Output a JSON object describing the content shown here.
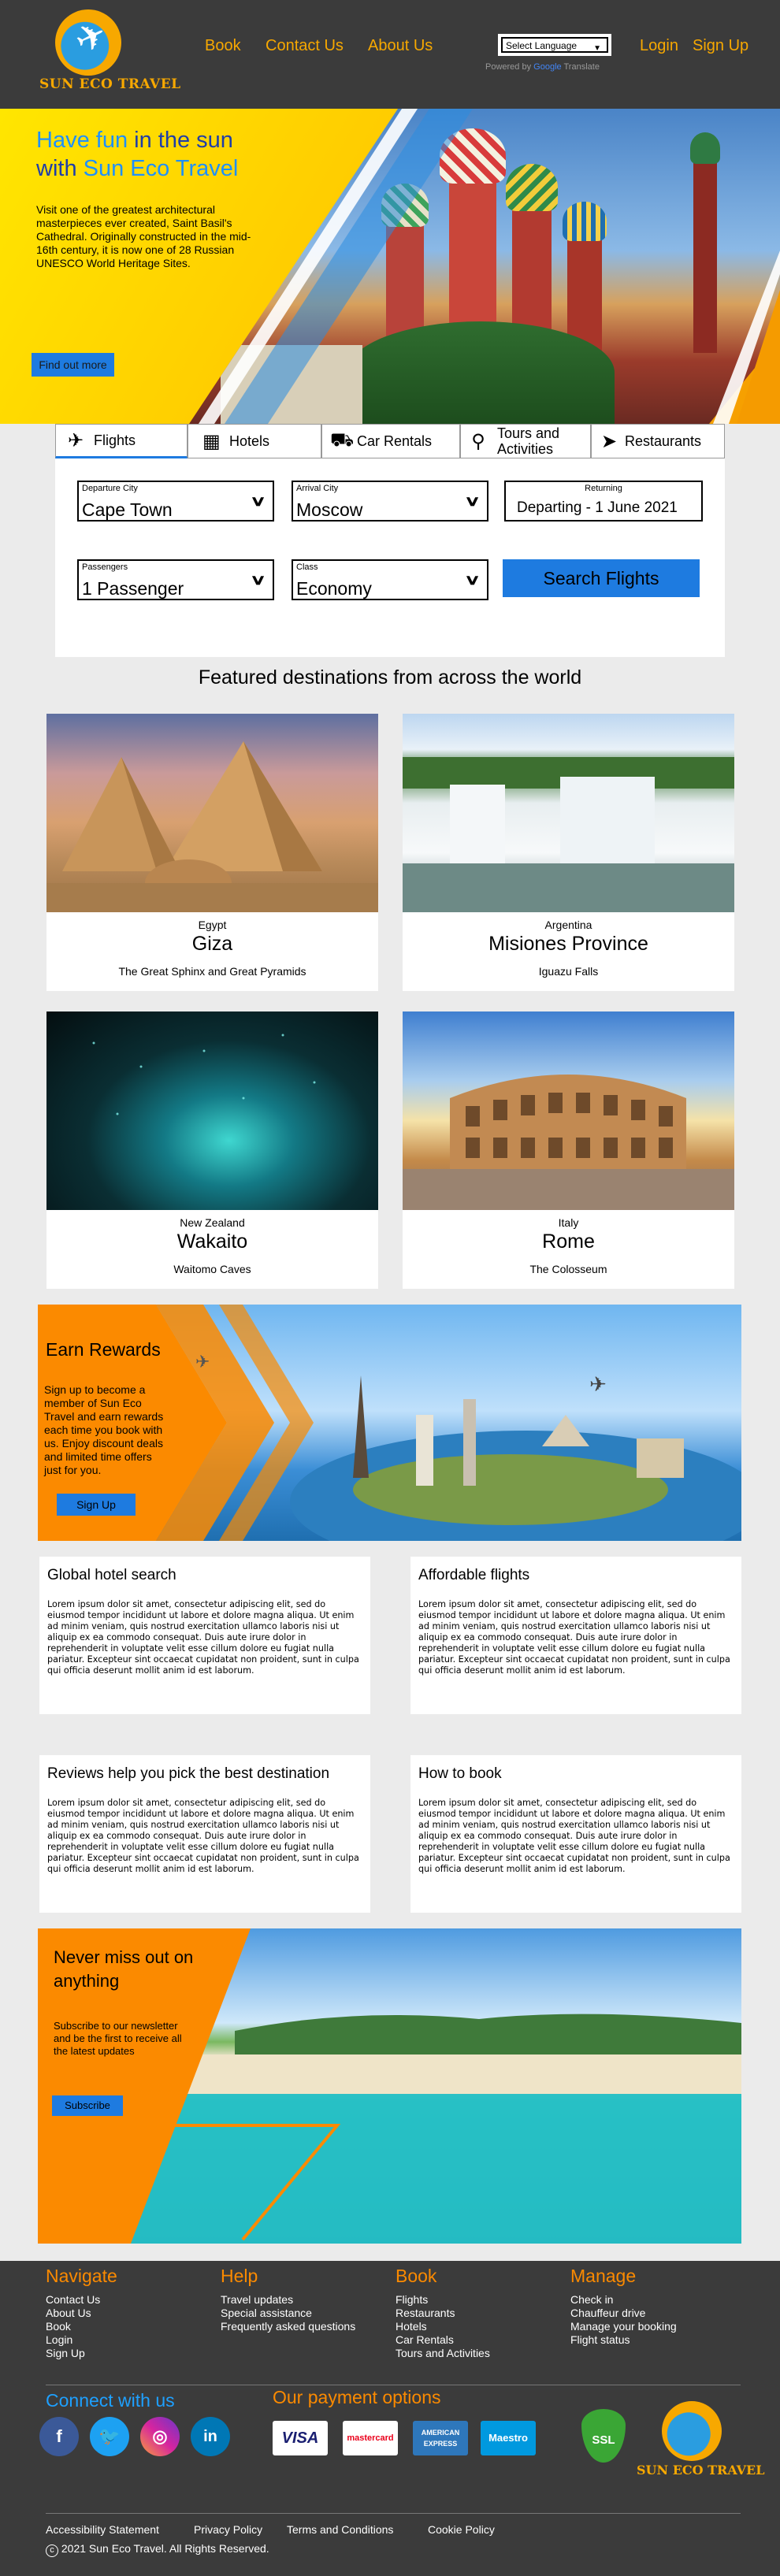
{
  "brand": {
    "name": "SUN ECO TRAVEL"
  },
  "nav": {
    "book": "Book",
    "contact": "Contact Us",
    "about": "About Us",
    "login": "Login",
    "signup": "Sign Up"
  },
  "translate": {
    "select_label": "Select Language",
    "powered_prefix": "Powered by",
    "google": "Google",
    "translate_word": "Translate"
  },
  "hero": {
    "title_part1": "Have fun",
    "title_part2": " in the sun",
    "title_part3": "with ",
    "title_part4": "Sun Eco Travel",
    "text": "Visit one of the greatest architectural masterpieces ever created, Saint Basil's Cathedral. Originally constructed in the mid-16th century, it is now one of 28 Russian UNESCO World Heritage Sites.",
    "button": "Find out more"
  },
  "search": {
    "tabs": [
      {
        "label": "Flights",
        "icon": "airplane-icon"
      },
      {
        "label": "Hotels",
        "icon": "hotel-icon"
      },
      {
        "label": "Car Rentals",
        "icon": "car-icon"
      },
      {
        "label": "Tours and Activities",
        "icon": "bicycle-icon"
      },
      {
        "label": "Restaurants",
        "icon": "restaurant-icon"
      }
    ],
    "departure": {
      "label": "Departure City",
      "value": "Cape Town"
    },
    "arrival": {
      "label": "Arrival City",
      "value": "Moscow"
    },
    "returning": {
      "label": "Returning",
      "value": "Departing - 1 June 2021"
    },
    "passengers": {
      "label": "Passengers",
      "value": "1 Passenger"
    },
    "class": {
      "label": "Class",
      "value": "Economy"
    },
    "button": "Search Flights"
  },
  "featured": {
    "title": "Featured destinations from across the world",
    "cards": [
      {
        "country": "Egypt",
        "city": "Giza",
        "desc": "The Great Sphinx and Great Pyramids"
      },
      {
        "country": "Argentina",
        "city": "Misiones Province",
        "desc": "Iguazu Falls"
      },
      {
        "country": "New Zealand",
        "city": "Wakaito",
        "desc": "Waitomo Caves"
      },
      {
        "country": "Italy",
        "city": "Rome",
        "desc": "The Colosseum"
      }
    ]
  },
  "rewards": {
    "title": "Earn Rewards",
    "text": "Sign up to become a member of Sun Eco Travel and earn rewards each time you book with us. Enjoy discount deals and limited time offers just for you.",
    "button": "Sign Up"
  },
  "info": [
    {
      "title": "Global hotel search",
      "text": "Lorem ipsum dolor sit amet, consectetur adipiscing elit, sed do eiusmod tempor incididunt ut labore et dolore magna aliqua. Ut enim ad minim veniam, quis nostrud exercitation ullamco laboris nisi ut aliquip ex ea commodo consequat. Duis aute irure dolor in reprehenderit in voluptate velit esse cillum dolore eu fugiat nulla pariatur. Excepteur sint occaecat cupidatat non proident, sunt in culpa qui officia deserunt mollit anim id est laborum."
    },
    {
      "title": "Affordable flights",
      "text": "Lorem ipsum dolor sit amet, consectetur adipiscing elit, sed do eiusmod tempor incididunt ut labore et dolore magna aliqua. Ut enim ad minim veniam, quis nostrud exercitation ullamco laboris nisi ut aliquip ex ea commodo consequat. Duis aute irure dolor in reprehenderit in voluptate velit esse cillum dolore eu fugiat nulla pariatur. Excepteur sint occaecat cupidatat non proident, sunt in culpa qui officia deserunt mollit anim id est laborum."
    },
    {
      "title": "Reviews help you pick the best destination",
      "text": "Lorem ipsum dolor sit amet, consectetur adipiscing elit, sed do eiusmod tempor incididunt ut labore et dolore magna aliqua. Ut enim ad minim veniam, quis nostrud exercitation ullamco laboris nisi ut aliquip ex ea commodo consequat. Duis aute irure dolor in reprehenderit in voluptate velit esse cillum dolore eu fugiat nulla pariatur. Excepteur sint occaecat cupidatat non proident, sunt in culpa qui officia deserunt mollit anim id est laborum."
    },
    {
      "title": "How to book",
      "text": "Lorem ipsum dolor sit amet, consectetur adipiscing elit, sed do eiusmod tempor incididunt ut labore et dolore magna aliqua. Ut enim ad minim veniam, quis nostrud exercitation ullamco laboris nisi ut aliquip ex ea commodo consequat. Duis aute irure dolor in reprehenderit in voluptate velit esse cillum dolore eu fugiat nulla pariatur. Excepteur sint occaecat cupidatat non proident, sunt in culpa qui officia deserunt mollit anim id est laborum."
    }
  ],
  "newsletter": {
    "title": "Never miss out on anything",
    "text": "Subscribe to our newsletter and be the first to receive all the latest updates",
    "button": "Subscribe"
  },
  "footer": {
    "navigate": {
      "title": "Navigate",
      "items": [
        "Contact Us",
        "About Us",
        "Book",
        "Login",
        "Sign Up"
      ]
    },
    "help": {
      "title": "Help",
      "items": [
        "Travel updates",
        "Special assistance",
        "Frequently asked questions"
      ]
    },
    "book": {
      "title": "Book",
      "items": [
        "Flights",
        "Restaurants",
        "Hotels",
        "Car Rentals",
        "Tours and Activities"
      ]
    },
    "manage": {
      "title": "Manage",
      "items": [
        "Check in",
        "Chauffeur drive",
        "Manage your booking",
        "Flight status"
      ]
    },
    "connect_title": "Connect with us",
    "payment_title": "Our payment options",
    "payments": [
      "VISA",
      "mastercard",
      "AMERICAN EXPRESS",
      "Maestro"
    ],
    "ssl": "SSL",
    "links": [
      "Accessibility Statement",
      "Privacy Policy",
      "Terms and Conditions",
      "Cookie Policy"
    ],
    "copyright": "2021 Sun Eco Travel. All Rights Reserved."
  },
  "colors": {
    "accent_orange": "#fb8a00",
    "accent_blue": "#1e7be0",
    "header_bg": "#3b3b3b",
    "page_bg": "#ebebeb"
  }
}
